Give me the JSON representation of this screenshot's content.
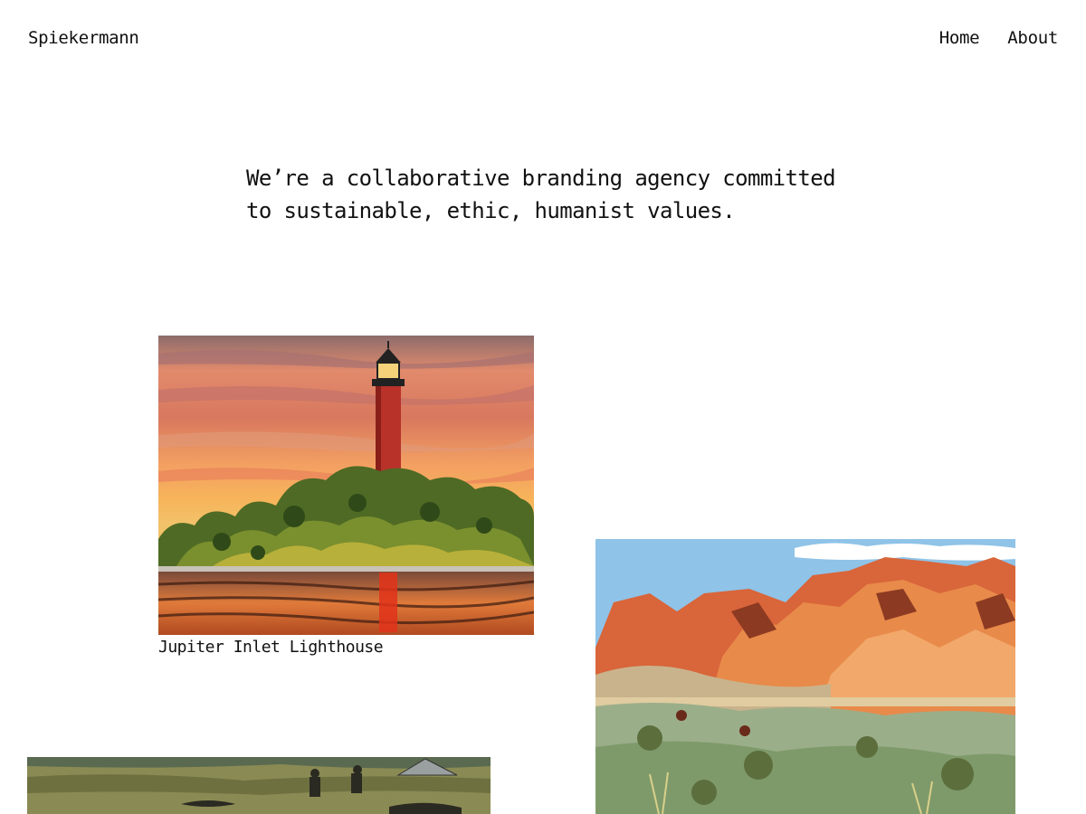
{
  "header": {
    "brand": "Spiekermann",
    "nav": [
      {
        "label": "Home"
      },
      {
        "label": "About"
      }
    ]
  },
  "intro": {
    "line1": "We’re a collaborative branding agency committed",
    "line2": "to sustainable, ethic, humanist values."
  },
  "gallery": [
    {
      "caption": "Jupiter Inlet Lighthouse",
      "icon": "lighthouse-illustration"
    },
    {
      "caption": "",
      "icon": "red-rock-canyon-illustration"
    },
    {
      "caption": "",
      "icon": "campsite-illustration"
    }
  ],
  "colors": {
    "background": "#ffffff",
    "text": "#111111",
    "sunset_orange": "#f39a4a",
    "lighthouse_red": "#b8322a",
    "canyon_rock": "#e0733a",
    "sky_blue": "#8fc3e8"
  }
}
